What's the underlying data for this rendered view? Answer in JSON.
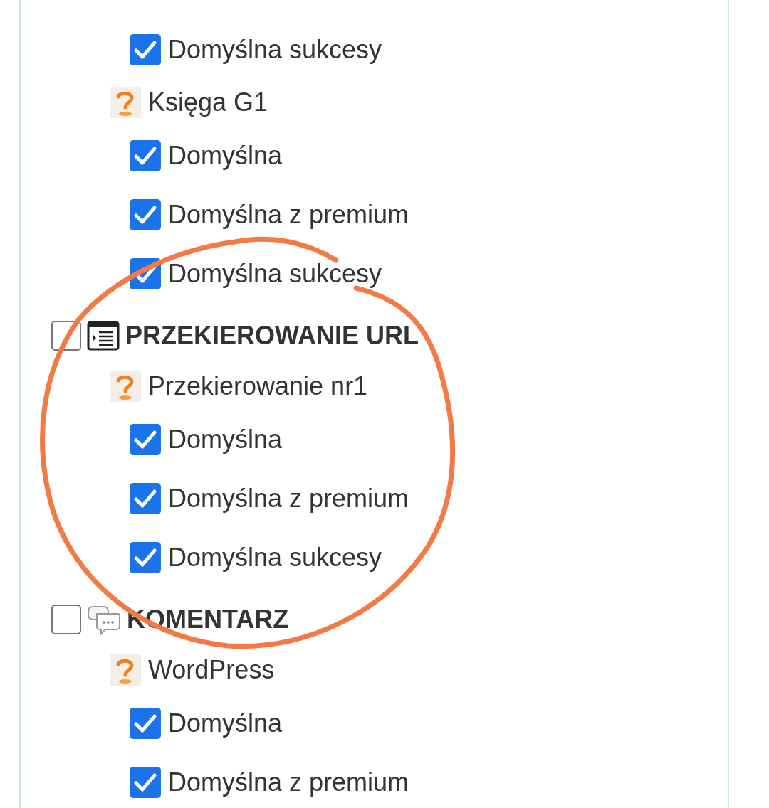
{
  "tree": [
    {
      "kind": "option",
      "label": "Domyślna sukcesy",
      "checked": true
    },
    {
      "kind": "entry",
      "label": "Księga G1",
      "children": [
        {
          "kind": "option",
          "label": "Domyślna",
          "checked": true
        },
        {
          "kind": "option",
          "label": "Domyślna z premium",
          "checked": true
        },
        {
          "kind": "option",
          "label": "Domyślna sukcesy",
          "checked": true
        }
      ]
    },
    {
      "kind": "group",
      "label": "PRZEKIEROWANIE URL",
      "checked": false,
      "children": [
        {
          "kind": "entry",
          "label": "Przekierowanie nr1",
          "children": [
            {
              "kind": "option",
              "label": "Domyślna",
              "checked": true
            },
            {
              "kind": "option",
              "label": "Domyślna z premium",
              "checked": true
            },
            {
              "kind": "option",
              "label": "Domyślna sukcesy",
              "checked": true
            }
          ]
        }
      ]
    },
    {
      "kind": "group",
      "label": "KOMENTARZ",
      "checked": false,
      "children": [
        {
          "kind": "entry",
          "label": "WordPress",
          "children": [
            {
              "kind": "option",
              "label": "Domyślna",
              "checked": true
            },
            {
              "kind": "option",
              "label": "Domyślna z premium",
              "checked": true
            }
          ]
        }
      ]
    }
  ]
}
